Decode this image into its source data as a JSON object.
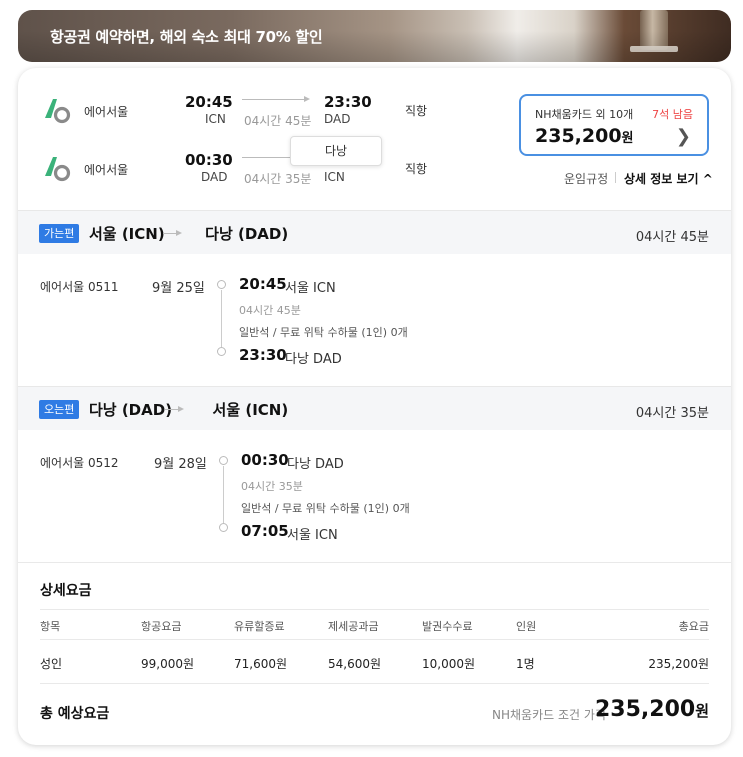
{
  "banner": {
    "text": "항공권 예약하면, 해외 숙소 최대 70% 할인"
  },
  "summary": {
    "outbound": {
      "airline": "에어서울",
      "dep_time": "20:45",
      "dep_code": "ICN",
      "duration": "04시간 45분",
      "arr_time": "23:30",
      "arr_code": "DAD",
      "type": "직항"
    },
    "inbound": {
      "airline": "에어서울",
      "dep_time": "00:30",
      "dep_code": "DAD",
      "duration": "04시간 35분",
      "arr_time": "",
      "arr_code": "ICN",
      "type": "직항"
    },
    "tooltip": "다낭"
  },
  "price_box": {
    "card": "NH채움카드 외 10개",
    "seats": "7석 남음",
    "price": "235,200",
    "currency": "원"
  },
  "links": {
    "fare_rules": "운임규정",
    "details": "상세 정보 보기 ^"
  },
  "departure": {
    "badge": "가는편",
    "from": "서울 (ICN)",
    "to": "다낭 (DAD)",
    "total_duration": "04시간 45분",
    "flight": "에어서울 0511",
    "date": "9월 25일",
    "dep_time": "20:45",
    "dep_place": "서울 ICN",
    "duration": "04시간 45분",
    "baggage": "일반석 / 무료 위탁 수하물 (1인) 0개",
    "arr_time": "23:30",
    "arr_place": "다낭 DAD"
  },
  "return": {
    "badge": "오는편",
    "from": "다낭 (DAD)",
    "to": "서울 (ICN)",
    "total_duration": "04시간 35분",
    "flight": "에어서울 0512",
    "date": "9월 28일",
    "dep_time": "00:30",
    "dep_place": "다낭 DAD",
    "duration": "04시간 35분",
    "baggage": "일반석 / 무료 위탁 수하물 (1인) 0개",
    "arr_time": "07:05",
    "arr_place": "서울 ICN"
  },
  "fare": {
    "title": "상세요금",
    "headers": [
      "항목",
      "항공요금",
      "유류할증료",
      "제세공과금",
      "발권수수료",
      "인원",
      "총요금"
    ],
    "row": [
      "성인",
      "99,000원",
      "71,600원",
      "54,600원",
      "10,000원",
      "1명",
      "235,200원"
    ],
    "total_label": "총 예상요금",
    "total_condition": "NH채움카드 조건 가격",
    "total_price": "235,200",
    "total_currency": "원"
  },
  "colors": {
    "accent": "#2f7be4",
    "price_border": "#4a90e2",
    "seats": "#e44444"
  }
}
